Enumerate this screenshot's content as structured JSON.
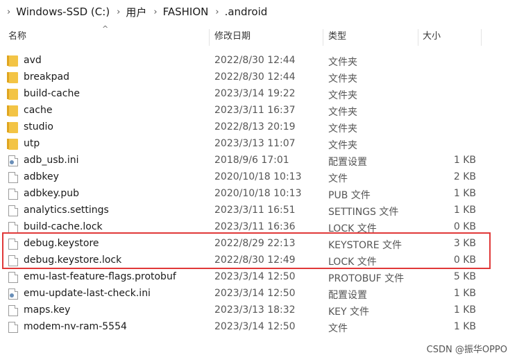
{
  "breadcrumb": [
    "Windows-SSD (C:)",
    "用户",
    "FASHION",
    ".android"
  ],
  "columns": {
    "name": "名称",
    "modified": "修改日期",
    "type": "类型",
    "size": "大小"
  },
  "files": [
    {
      "name": "avd",
      "date": "2022/8/30 12:44",
      "type": "文件夹",
      "size": "",
      "icon": "folder"
    },
    {
      "name": "breakpad",
      "date": "2022/8/30 12:44",
      "type": "文件夹",
      "size": "",
      "icon": "folder"
    },
    {
      "name": "build-cache",
      "date": "2023/3/14 19:22",
      "type": "文件夹",
      "size": "",
      "icon": "folder"
    },
    {
      "name": "cache",
      "date": "2023/3/11 16:37",
      "type": "文件夹",
      "size": "",
      "icon": "folder"
    },
    {
      "name": "studio",
      "date": "2022/8/13 20:19",
      "type": "文件夹",
      "size": "",
      "icon": "folder"
    },
    {
      "name": "utp",
      "date": "2023/3/13 11:07",
      "type": "文件夹",
      "size": "",
      "icon": "folder"
    },
    {
      "name": "adb_usb.ini",
      "date": "2018/9/6 17:01",
      "type": "配置设置",
      "size": "1 KB",
      "icon": "ini"
    },
    {
      "name": "adbkey",
      "date": "2020/10/18 10:13",
      "type": "文件",
      "size": "2 KB",
      "icon": "file"
    },
    {
      "name": "adbkey.pub",
      "date": "2020/10/18 10:13",
      "type": "PUB 文件",
      "size": "1 KB",
      "icon": "file"
    },
    {
      "name": "analytics.settings",
      "date": "2023/3/11 16:51",
      "type": "SETTINGS 文件",
      "size": "1 KB",
      "icon": "file"
    },
    {
      "name": "build-cache.lock",
      "date": "2023/3/11 16:36",
      "type": "LOCK 文件",
      "size": "0 KB",
      "icon": "file"
    },
    {
      "name": "debug.keystore",
      "date": "2022/8/29 22:13",
      "type": "KEYSTORE 文件",
      "size": "3 KB",
      "icon": "file"
    },
    {
      "name": "debug.keystore.lock",
      "date": "2022/8/30 12:49",
      "type": "LOCK 文件",
      "size": "0 KB",
      "icon": "file"
    },
    {
      "name": "emu-last-feature-flags.protobuf",
      "date": "2023/3/14 12:50",
      "type": "PROTOBUF 文件",
      "size": "5 KB",
      "icon": "file"
    },
    {
      "name": "emu-update-last-check.ini",
      "date": "2023/3/14 12:50",
      "type": "配置设置",
      "size": "1 KB",
      "icon": "ini"
    },
    {
      "name": "maps.key",
      "date": "2023/3/13 18:32",
      "type": "KEY 文件",
      "size": "1 KB",
      "icon": "file"
    },
    {
      "name": "modem-nv-ram-5554",
      "date": "2023/3/14 12:50",
      "type": "文件",
      "size": "1 KB",
      "icon": "file"
    }
  ],
  "watermark": "CSDN @振华OPPO"
}
